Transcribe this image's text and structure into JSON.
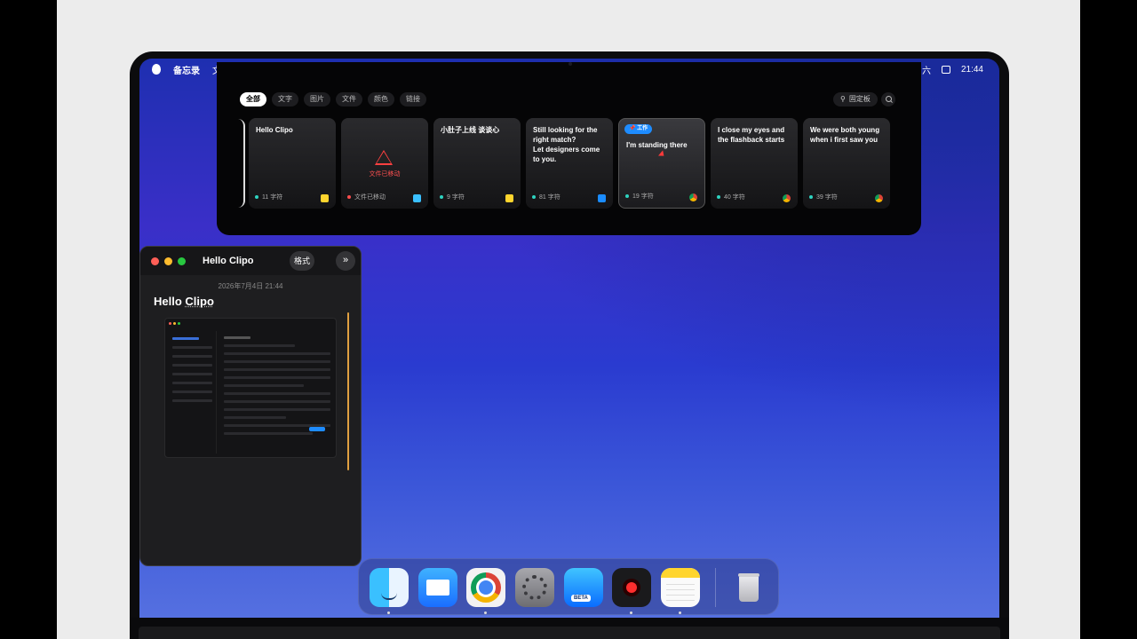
{
  "menubar": {
    "app_name": "备忘录",
    "menu_first": "文件",
    "weekday": "六",
    "time": "21:44"
  },
  "clipboard": {
    "filters": [
      "全部",
      "文字",
      "图片",
      "文件",
      "颜色",
      "链接"
    ],
    "pin_label": "固定板",
    "cards": [
      {
        "title": "Hello Clipo",
        "meta": "11 字符",
        "app_icon": "notes-icon",
        "icon_color": "#ffd52e"
      },
      {
        "title": "",
        "warning_text": "文件已移动",
        "meta": "文件已移动",
        "app_icon": "finder-icon",
        "icon_color": "#3ac0ff"
      },
      {
        "title": "小肚子上线 谈谈心",
        "meta": "9 字符",
        "app_icon": "notes-icon",
        "icon_color": "#ffd52e"
      },
      {
        "title": "Still looking for the\nright match?\nLet designers come\nto you.",
        "meta": "81 字符",
        "app_icon": "mail-icon",
        "icon_color": "#1a8cff"
      },
      {
        "tag": "工作",
        "title": "I'm standing there",
        "meta": "19 字符",
        "app_icon": "chrome-icon",
        "icon_color": "#0f9d58"
      },
      {
        "title": "I close my eyes and\nthe flashback starts",
        "meta": "40 字符",
        "app_icon": "chrome-icon",
        "icon_color": "#0f9d58"
      },
      {
        "title": "We were both young\nwhen i first saw you",
        "meta": "39 字符",
        "app_icon": "chrome-icon",
        "icon_color": "#0f9d58"
      }
    ]
  },
  "editor": {
    "window_title": "Hello Clipo",
    "format_label": "格式",
    "more_label": "»",
    "date": "2026年7月4日 21:44",
    "heading_prefix": "Hello ",
    "heading_word": "Clipo"
  },
  "dock": {
    "apps": [
      "finder-icon",
      "mail-icon",
      "chrome-icon",
      "system-settings-icon",
      "xcode-beta-icon",
      "screen-recorder-icon",
      "notes-icon",
      "trash-icon"
    ]
  }
}
